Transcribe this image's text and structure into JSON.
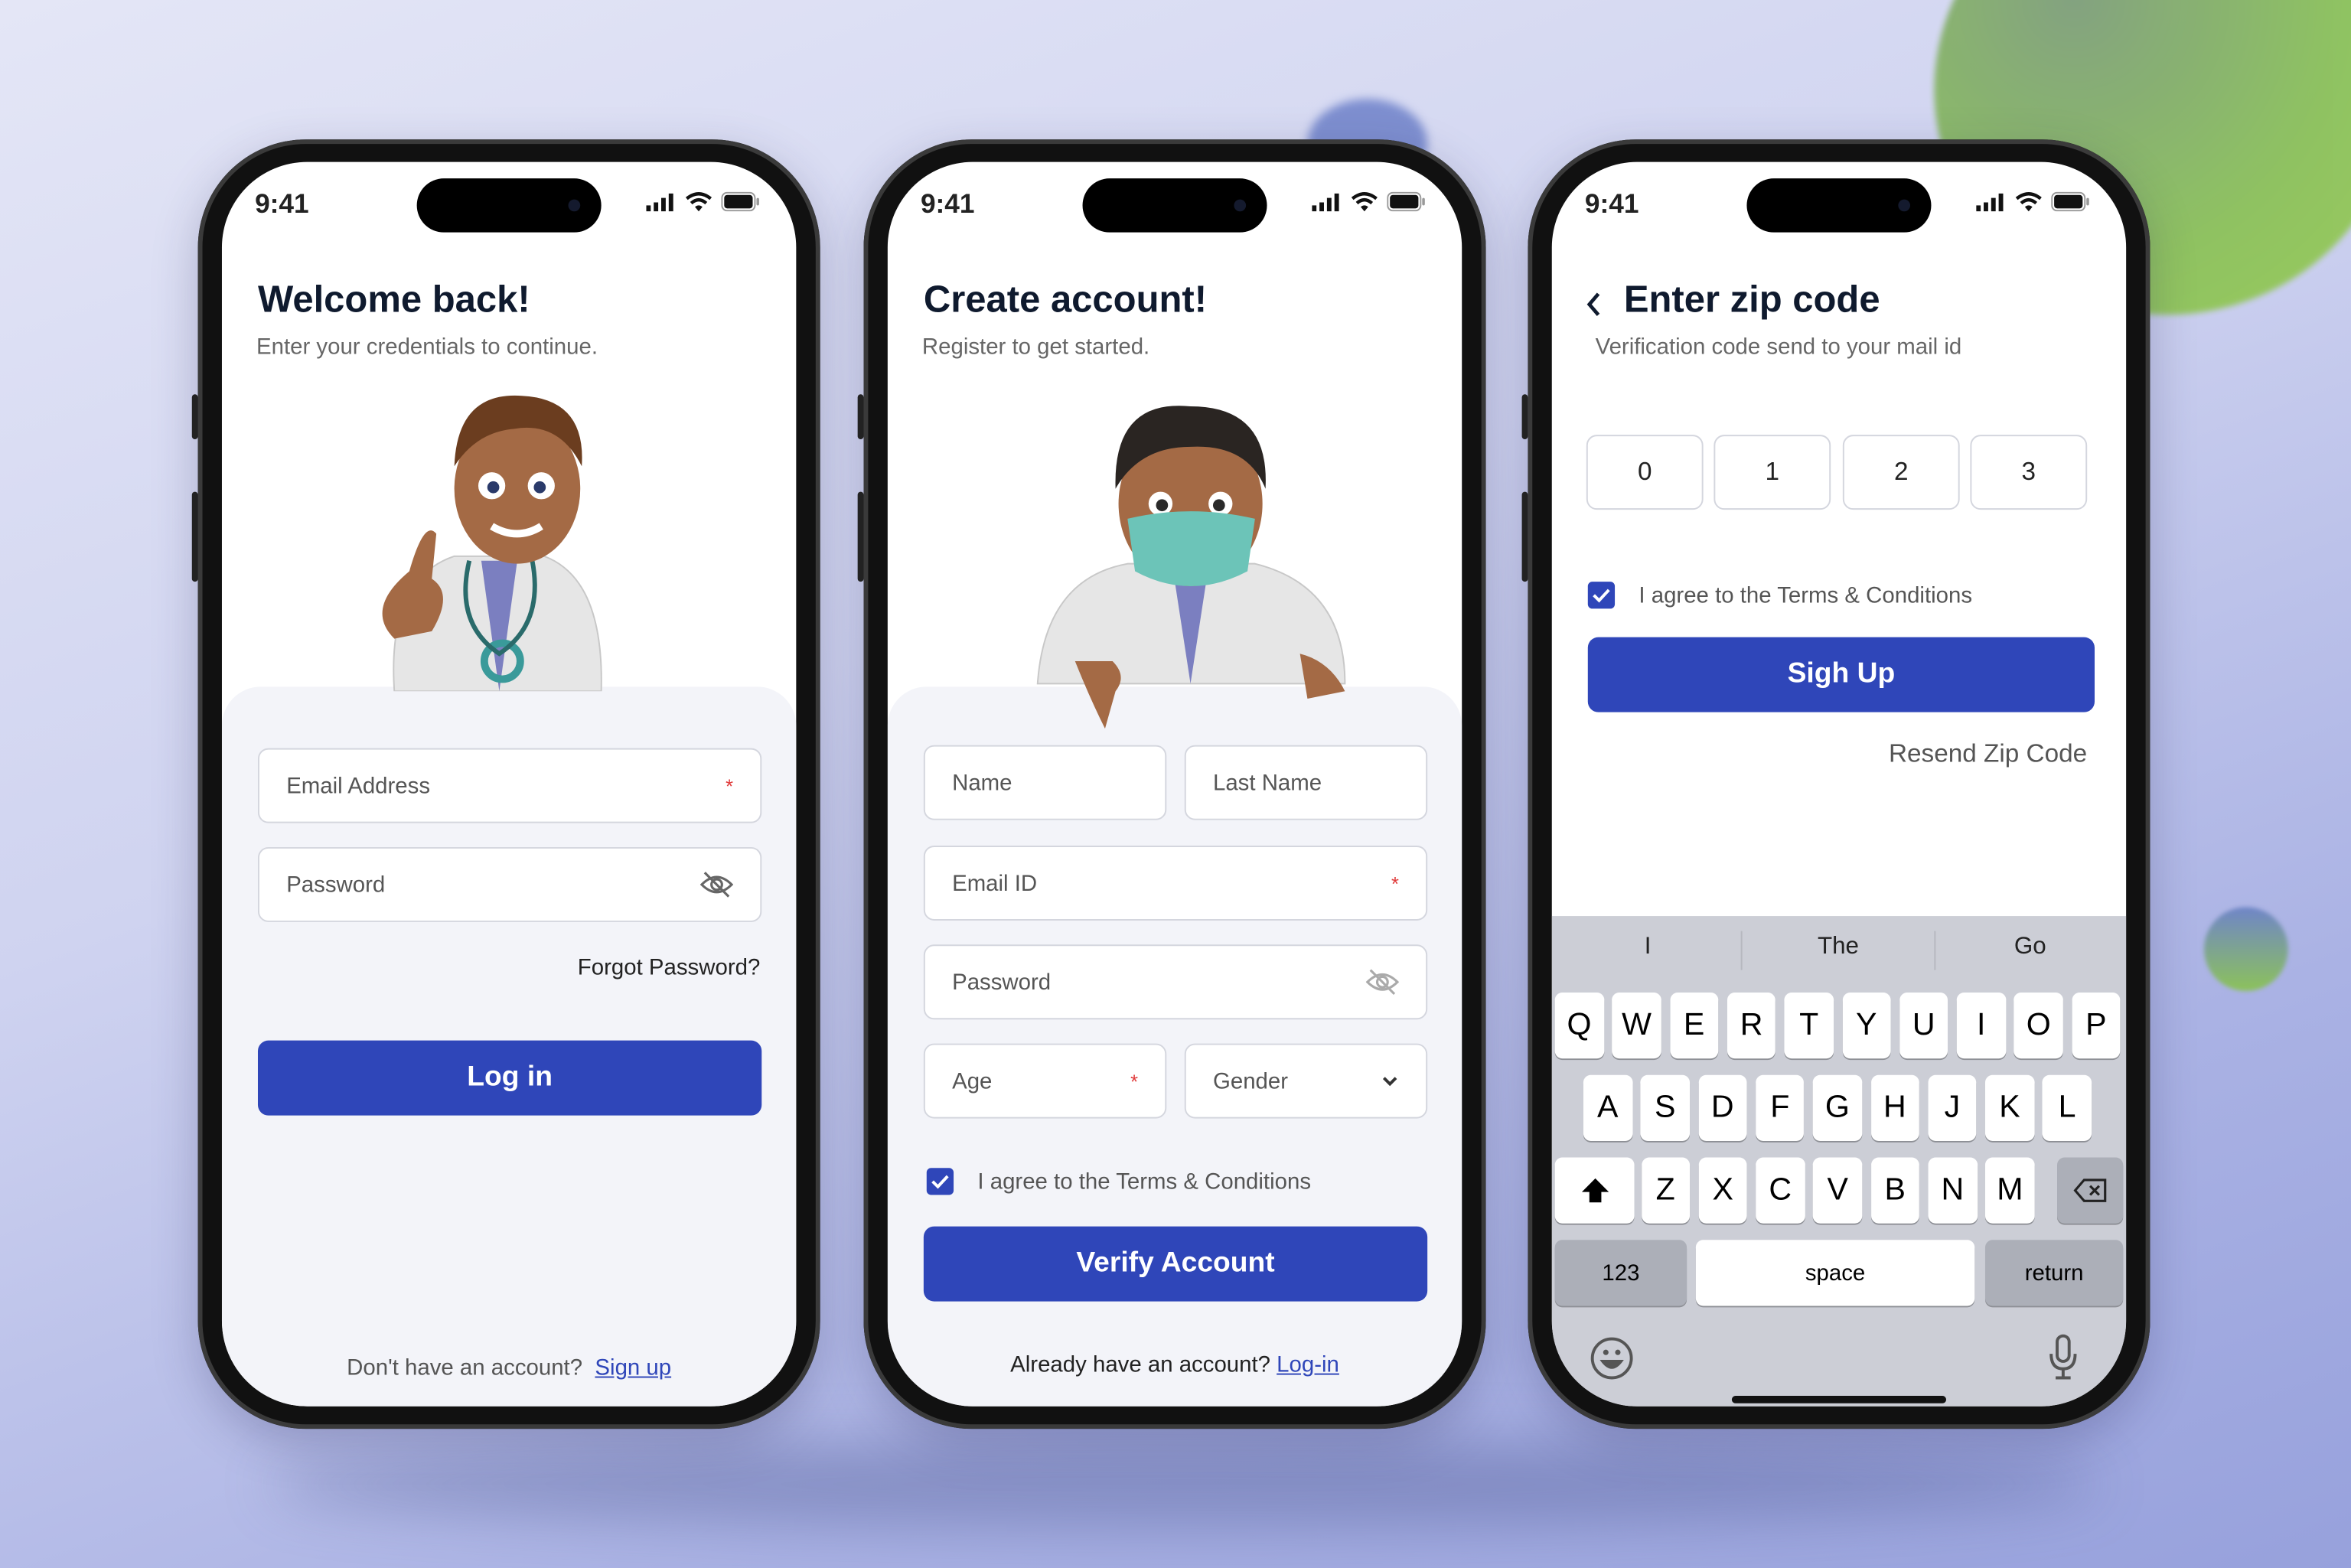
{
  "status": {
    "time": "9:41"
  },
  "login": {
    "title": "Welcome back!",
    "subtitle": "Enter your credentials to continue.",
    "email_placeholder": "Email Address",
    "password_placeholder": "Password",
    "required_mark": "*",
    "forgot": "Forgot Password?",
    "login_button": "Log in",
    "footer_text": "Don't have an account?",
    "footer_link": "Sign up"
  },
  "signup": {
    "title": "Create account!",
    "subtitle": "Register to get started.",
    "name_placeholder": "Name",
    "last_name_placeholder": "Last Name",
    "email_placeholder": "Email ID",
    "password_placeholder": "Password",
    "age_placeholder": "Age",
    "gender_placeholder": "Gender",
    "required_mark": "*",
    "terms": "I agree to the Terms & Conditions",
    "terms_checked": true,
    "verify_button": "Verify Account",
    "footer_text": "Already have an account?",
    "footer_link": "Log-in"
  },
  "zip": {
    "title": "Enter zip code",
    "subtitle": "Verification code send to your mail id",
    "digits": [
      "0",
      "1",
      "2",
      "3"
    ],
    "terms": "I agree to the Terms & Conditions",
    "terms_checked": true,
    "signup_button": "Sigh Up",
    "resend": "Resend Zip Code",
    "keyboard": {
      "suggestions": [
        "I",
        "The",
        "Go"
      ],
      "rows": [
        [
          "Q",
          "W",
          "E",
          "R",
          "T",
          "Y",
          "U",
          "I",
          "O",
          "P"
        ],
        [
          "A",
          "S",
          "D",
          "F",
          "G",
          "H",
          "J",
          "K",
          "L"
        ],
        [
          "Z",
          "X",
          "C",
          "V",
          "B",
          "N",
          "M"
        ]
      ],
      "numbers": "123",
      "space": "space",
      "return": "return"
    }
  },
  "colors": {
    "accent": "#2f46b9",
    "required": "#e03a3a",
    "panel": "#f3f4f9"
  }
}
